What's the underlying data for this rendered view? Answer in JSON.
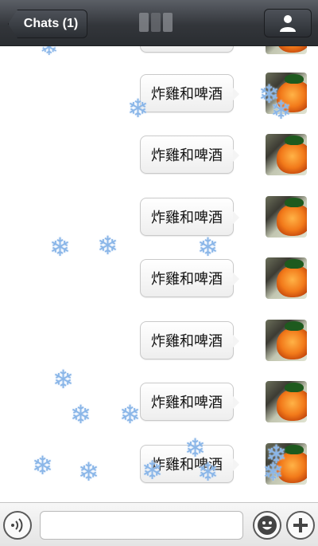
{
  "navbar": {
    "back_label": "Chats (1)",
    "title_obscured": true
  },
  "messages": [
    {
      "text": "炸雞和啤酒",
      "sender": "me"
    },
    {
      "text": "炸雞和啤酒",
      "sender": "me"
    },
    {
      "text": "炸雞和啤酒",
      "sender": "me"
    },
    {
      "text": "炸雞和啤酒",
      "sender": "me"
    },
    {
      "text": "炸雞和啤酒",
      "sender": "me"
    },
    {
      "text": "炸雞和啤酒",
      "sender": "me"
    },
    {
      "text": "炸雞和啤酒",
      "sender": "me"
    }
  ],
  "overlay": {
    "effect": "snowflake-icon",
    "glyph": "❄"
  },
  "input": {
    "placeholder": "",
    "value": ""
  },
  "icons": {
    "profile": "person-icon",
    "voice": "voice-icon",
    "emoji": "smiley-icon",
    "plus": "plus-icon"
  },
  "colors": {
    "navbar": "#33363b",
    "snowflake": "#8ab6e8",
    "bubble": "#ffffff"
  }
}
